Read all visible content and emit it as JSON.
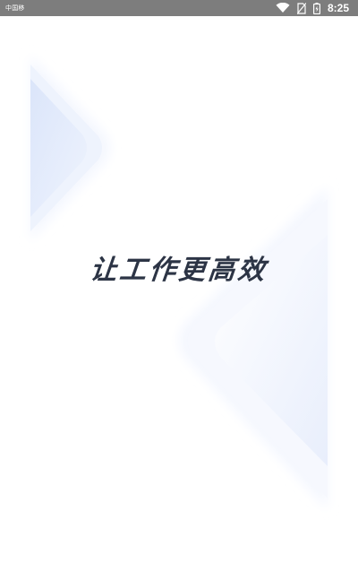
{
  "status_bar": {
    "carrier": "中国移",
    "time": "8:25",
    "icons": [
      "wifi-icon",
      "no-sim-icon",
      "battery-icon"
    ]
  },
  "splash": {
    "slogan": "让工作更高效"
  },
  "colors": {
    "status_bar_bg": "#7d7d7d",
    "slogan": "#2c3445",
    "accent_shape": "#e3ebfb"
  }
}
